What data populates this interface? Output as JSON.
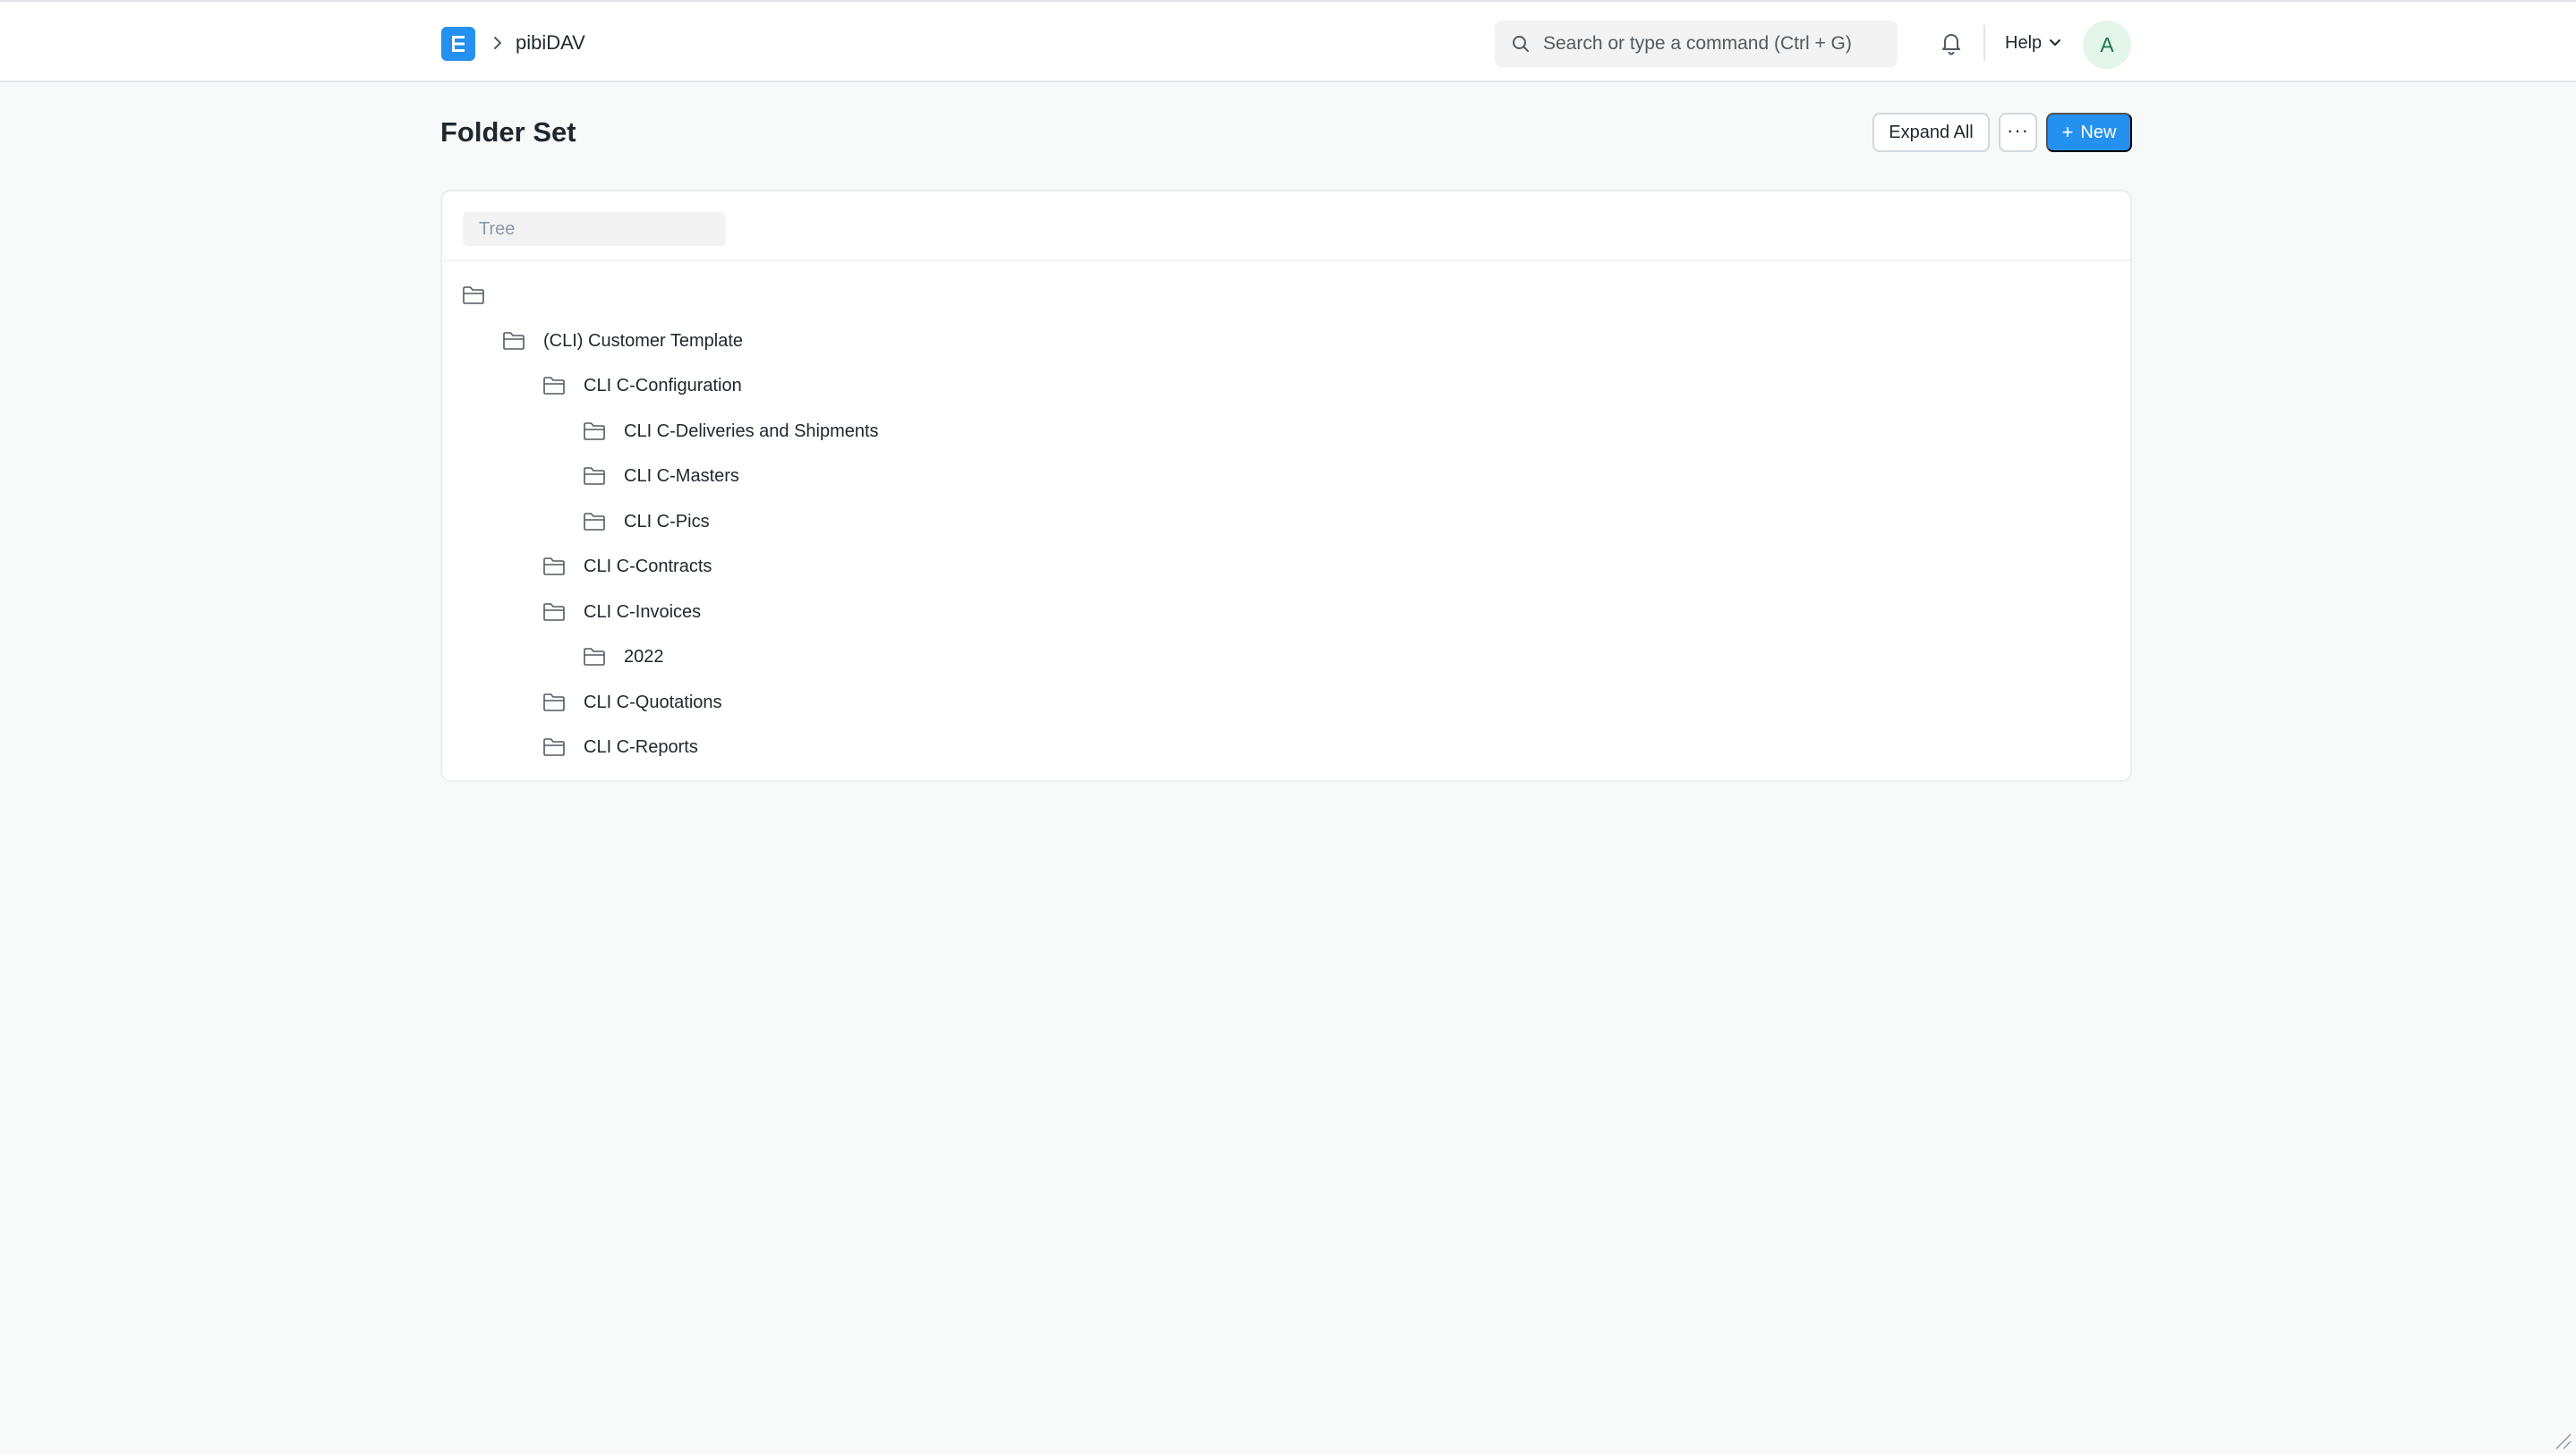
{
  "navbar": {
    "logo_letter": "E",
    "breadcrumb": "pibiDAV",
    "search_placeholder": "Search or type a command (Ctrl + G)",
    "help_label": "Help",
    "avatar_initial": "A"
  },
  "page": {
    "title": "Folder Set",
    "expand_all_label": "Expand All",
    "more_label": "···",
    "new_label": "New",
    "new_plus": "+"
  },
  "tree": {
    "filter_placeholder": "Tree",
    "nodes": [
      {
        "label": "",
        "depth": 0
      },
      {
        "label": "(CLI) Customer Template",
        "depth": 1
      },
      {
        "label": "CLI C-Configuration",
        "depth": 2
      },
      {
        "label": "CLI C-Deliveries and Shipments",
        "depth": 3
      },
      {
        "label": "CLI C-Masters",
        "depth": 3
      },
      {
        "label": "CLI C-Pics",
        "depth": 3
      },
      {
        "label": "CLI C-Contracts",
        "depth": 2
      },
      {
        "label": "CLI C-Invoices",
        "depth": 2
      },
      {
        "label": "2022",
        "depth": 3
      },
      {
        "label": "CLI C-Quotations",
        "depth": 2
      },
      {
        "label": "CLI C-Reports",
        "depth": 2
      }
    ]
  },
  "colors": {
    "accent": "#2490ef",
    "background": "#f8f9f9",
    "text": "#1f272e",
    "avatar_bg": "#e4f5e9",
    "avatar_text": "#16794c"
  }
}
